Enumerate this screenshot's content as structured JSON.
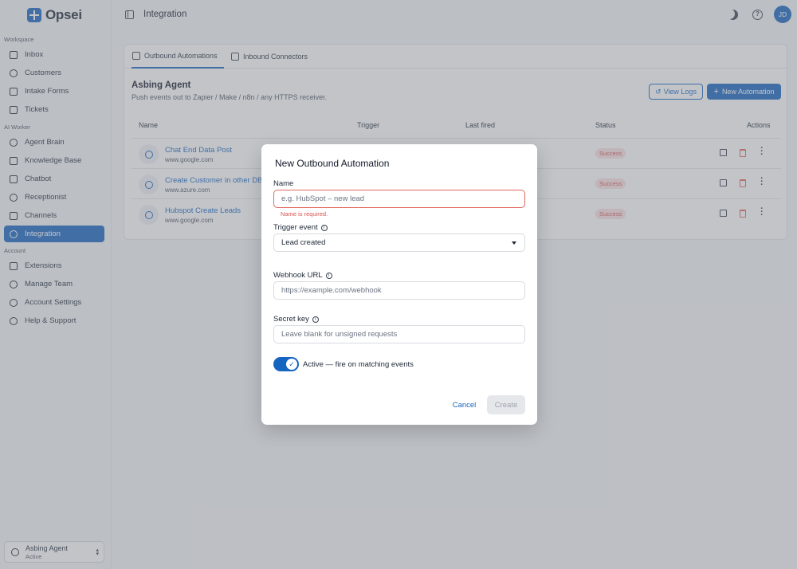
{
  "app": {
    "name": "Opsei"
  },
  "sidebar": {
    "sections": [
      {
        "label": "Workspace"
      },
      {
        "label": "AI Worker"
      },
      {
        "label": "Account"
      }
    ],
    "items": [
      {
        "label": "Inbox",
        "icon": "inbox-icon"
      },
      {
        "label": "Customers",
        "icon": "user-icon"
      },
      {
        "label": "Intake Forms",
        "icon": "form-icon"
      },
      {
        "label": "Tickets",
        "icon": "ticket-icon"
      },
      {
        "label": "Agent Brain",
        "icon": "brain-icon"
      },
      {
        "label": "Knowledge Base",
        "icon": "database-icon"
      },
      {
        "label": "Chatbot",
        "icon": "chat-icon"
      },
      {
        "label": "Receptionist",
        "icon": "phone-icon"
      },
      {
        "label": "Channels",
        "icon": "grid-icon"
      },
      {
        "label": "Integration",
        "icon": "rocket-icon",
        "active": true
      },
      {
        "label": "Extensions",
        "icon": "puzzle-icon"
      },
      {
        "label": "Manage Team",
        "icon": "team-icon"
      },
      {
        "label": "Account Settings",
        "icon": "settings-icon"
      },
      {
        "label": "Help & Support",
        "icon": "help-icon"
      }
    ],
    "agent": {
      "name": "Asbing Agent",
      "status": "Active"
    }
  },
  "topbar": {
    "title": "Integration",
    "avatar_initials": "JD"
  },
  "tabs": [
    {
      "label": "Outbound Automations",
      "active": true
    },
    {
      "label": "Inbound Connectors"
    }
  ],
  "section": {
    "title": "Asbing Agent",
    "subtitle": "Push events out to Zapier / Make / n8n / any HTTPS receiver.",
    "view_logs": "View Logs",
    "new_automation": "New Automation"
  },
  "table": {
    "headers": {
      "name": "Name",
      "trigger": "Trigger",
      "last_fired": "Last fired",
      "status": "Status",
      "actions": "Actions"
    },
    "rows": [
      {
        "name": "Chat End Data Post",
        "url": "www.google.com",
        "status": "Success"
      },
      {
        "name": "Create Customer in other DB",
        "url": "www.azure.com",
        "status": "Success"
      },
      {
        "name": "Hubspot Create Leads",
        "url": "www.google.com",
        "status": "Success"
      }
    ]
  },
  "modal": {
    "title": "New Outbound Automation",
    "name_label": "Name",
    "name_placeholder": "e.g. HubSpot – new lead",
    "name_value": "",
    "name_error": "Name is required.",
    "trigger_label": "Trigger event",
    "trigger_value": "Lead created",
    "webhook_label": "Webhook URL",
    "webhook_placeholder": "https://example.com/webhook",
    "secret_label": "Secret key",
    "secret_placeholder": "Leave blank for unsigned requests",
    "active_label": "Active — fire on matching events",
    "active": true,
    "cancel": "Cancel",
    "create": "Create"
  },
  "colors": {
    "accent": "#1565c0",
    "error": "#d9534f",
    "success_badge_bg": "#fbe2e2"
  }
}
